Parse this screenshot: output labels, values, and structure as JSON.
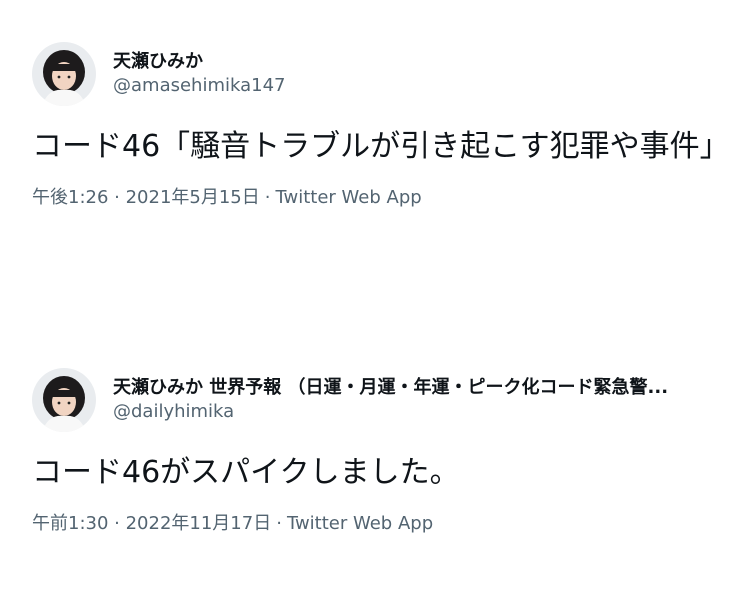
{
  "tweets": [
    {
      "display_name": "天瀬ひみか",
      "handle": "@amasehimika147",
      "text": "コード46「騒音トラブルが引き起こす犯罪や事件」",
      "timestamp": "午後1:26 · 2021年5月15日",
      "separator": "·",
      "source": "Twitter Web App"
    },
    {
      "display_name": "天瀬ひみか 世界予報 （日運・月運・年運・ピーク化コード緊急警...",
      "handle": "@dailyhimika",
      "text": "コード46がスパイクしました。",
      "timestamp": "午前1:30 · 2022年11月17日",
      "separator": "·",
      "source": "Twitter Web App"
    }
  ],
  "colors": {
    "text_primary": "#0f1419",
    "text_secondary": "#536471",
    "background": "#ffffff"
  }
}
